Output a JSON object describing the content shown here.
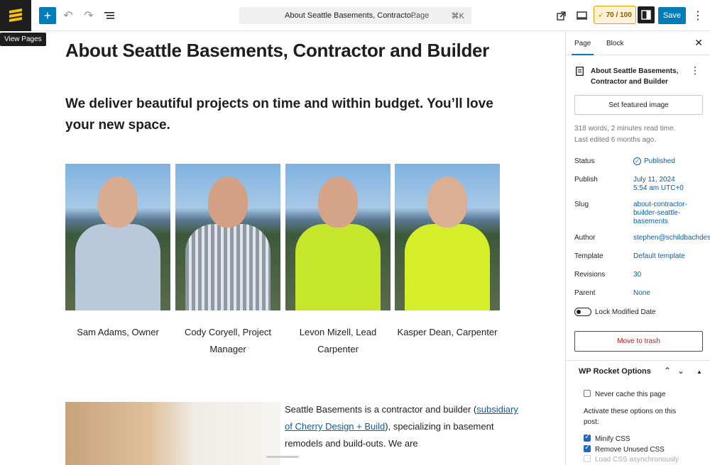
{
  "toolbar": {
    "tooltip": "View Pages",
    "command_title": "About Seattle Basements, Contracto…",
    "command_type": "· Page",
    "shortcut": "⌘K",
    "score": "70 / 100",
    "save_label": "Save"
  },
  "page": {
    "title": "About Seattle Basements, Contractor and Builder",
    "lead": "We deliver beautiful projects on time and within budget.  You’ll love your new space.",
    "team": [
      {
        "name": "Sam Adams, Owner"
      },
      {
        "name": "Cody Coryell, Project Manager"
      },
      {
        "name": "Levon Mizell, Lead Carpenter"
      },
      {
        "name": "Kasper Dean, Carpenter"
      }
    ],
    "para_start": "Seattle Basements is a contractor and builder (",
    "para_link": "subsidiary of Cherry Design + Build",
    "para_end": "), specializing in basement remodels and build-outs.  We are"
  },
  "sidebar": {
    "tab_page": "Page",
    "tab_block": "Block",
    "doc_title": "About Seattle Basements, Contractor and Builder",
    "featured_button": "Set featured image",
    "stats": "318 words, 2 minutes read time.",
    "last_edited": "Last edited 6 months ago.",
    "status_label": "Status",
    "status_value": "Published",
    "publish_label": "Publish",
    "publish_date": "July 11, 2024",
    "publish_time": "5:54 am UTC+0",
    "slug_label": "Slug",
    "slug_1": "about-contractor-",
    "slug_2": "builder-seattle-",
    "slug_3": "basements",
    "author_label": "Author",
    "author_value": "stephen@schildbachdes",
    "template_label": "Template",
    "template_value": "Default template",
    "revisions_label": "Revisions",
    "revisions_value": "30",
    "parent_label": "Parent",
    "parent_value": "None",
    "lock_label": "Lock Modified Date",
    "trash_label": "Move to trash",
    "wpr_title": "WP Rocket Options",
    "never_cache": "Never cache this page",
    "activate_text": "Activate these options on this post:",
    "minify": "Minify CSS",
    "remove_css": "Remove Unused CSS",
    "load_async": "Load CSS asynchronously"
  }
}
